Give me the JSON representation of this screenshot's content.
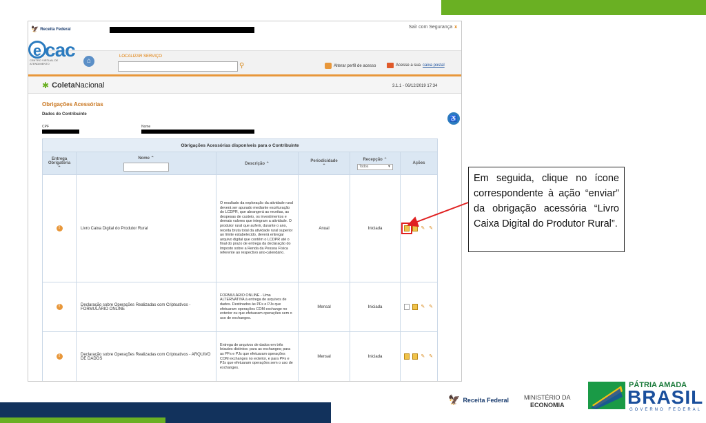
{
  "shot": {
    "top_logo_text": "Receita Federal",
    "sair_text": "Sair com Segurança",
    "sair_x": "x",
    "ecac": {
      "e": "e",
      "cac": "cac",
      "sub": "CENTRO VIRTUAL DE ATENDIMENTO"
    },
    "localizar_label": "LOCALIZAR SERVIÇO",
    "alterar_perfil": "Alterar perfil de acesso",
    "acesse_caixa_prefix": "Acesse a sua",
    "acesse_caixa_link": "caixa postal",
    "coleta_a": "Coleta",
    "coleta_b": "Nacional",
    "version": "3.1.1 - 06/12/2019 17:34",
    "section_title": "Obrigações Acessórias",
    "dados_contribuinte": "Dados do Contribuinte",
    "cpf_label": "CPF",
    "nome_label": "Nome",
    "table_caption": "Obrigações Acessórias disponíveis para o Contribuinte",
    "columns": {
      "entrega": "Entrega Obrigatória",
      "nome": "Nome",
      "descricao": "Descrição",
      "periodicidade": "Periodicidade",
      "recepcao": "Recepção",
      "acoes": "Ações"
    },
    "recepcao_select": "Todos",
    "rows": [
      {
        "nome": "Livro Caixa Digital do Produtor Rural",
        "descricao": "O resultado da exploração da atividade rural deverá ser apurado mediante escrituração do LCDPR, que abrangerá as receitas, as despesas de custeio, os investimentos e demais valores que integram a atividade. O produtor rural que auferir, durante o ano, receita bruta total da atividade rural superior ao limite estabelecido, deverá entregar arquivo digital que contêm o LCDPR até o final do prazo de entrega da declaração do Imposto sobre a Renda da Pessoa Física referente ao respectivo ano-calendário.",
        "periodicidade": "Anual",
        "recepcao": "Iniciada"
      },
      {
        "nome": "Declaração sobre Operações Realizadas com Criptoativos - FORMULÁRIO ONLINE",
        "descricao": "FORMULÁRIO ONLINE - Uma ALTERNATIVA à entrega de arquivos de dados. Destinados às PFs e PJs que efetuaram operações COM exchange no exterior ou que efetuaram operações sem o uso de exchanges.",
        "periodicidade": "Mensal",
        "recepcao": "Iniciada"
      },
      {
        "nome": "Declaração sobre Operações Realizadas com Criptoativos - ARQUIVO DE DADOS",
        "descricao": "Entrega de arquivos de dados em três leiautes distintos: para as exchanges; para as PFs e PJs que efetuaram operações COM exchanges no exterior, e para PFs e PJs que efetuaram operações sem o uso de exchanges.",
        "periodicidade": "Mensal",
        "recepcao": "Iniciada"
      }
    ]
  },
  "callout": "Em seguida, clique no ícone correspondente à ação “enviar” da obrigação acessória “Livro Caixa Digital do Produtor Rural”.",
  "footer": {
    "receita": "Receita Federal",
    "ministerio_1": "MINISTÉRIO DA",
    "ministerio_2": "ECONOMIA",
    "patria": "PÁTRIA AMADA",
    "brasil": "BRASIL",
    "governo": "GOVERNO FEDERAL"
  },
  "colors": {
    "green": "#6ab023",
    "navy": "#12325c",
    "orange": "#e8973a",
    "blue": "#2b7bbf",
    "highlight": "#e02020"
  }
}
